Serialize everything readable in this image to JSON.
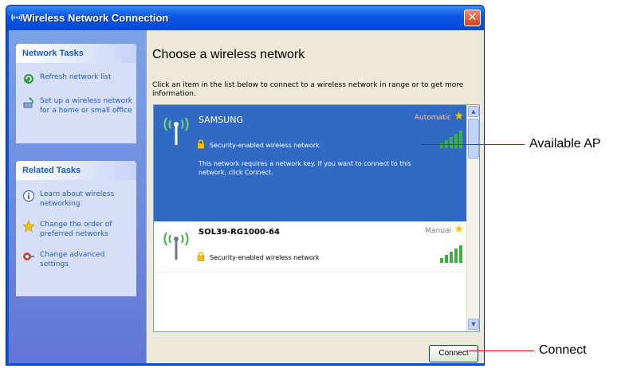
{
  "window": {
    "title": "Wireless Network Connection",
    "close_label": "✕"
  },
  "left_pane": {
    "network_tasks": {
      "header": "Network Tasks",
      "items": [
        {
          "label": "Refresh network list",
          "icon": "refresh-icon"
        },
        {
          "label": "Set up a wireless network for a home or small office",
          "icon": "wireless-setup-icon"
        }
      ]
    },
    "related_tasks": {
      "header": "Related Tasks",
      "items": [
        {
          "label": "Learn about wireless networking",
          "icon": "info-icon"
        },
        {
          "label": "Change the order of preferred networks",
          "icon": "star-icon"
        },
        {
          "label": "Change advanced settings",
          "icon": "settings-icon"
        }
      ]
    }
  },
  "main": {
    "heading": "Choose a wireless network",
    "instruction": "Click an item in the list below to connect to a wireless network in range or to get more information.",
    "networks": [
      {
        "name": "SAMSUNG",
        "mode": "Automatic",
        "security": "Security-enabled wireless network",
        "description": "This network requires a network key. If you want to connect to this network, click Connect.",
        "selected": true,
        "signal_bars": 5
      },
      {
        "name": "SOL39-RG1000-64",
        "mode": "Manual",
        "security": "Security-enabled wireless network",
        "selected": false,
        "signal_bars": 5
      }
    ],
    "connect_button": "Connect"
  },
  "callouts": {
    "available_ap": "Available AP",
    "connect": "Connect"
  },
  "colors": {
    "title_bar": "#0a56e6",
    "selected_row": "#316ac5",
    "callout_line": "#d80000",
    "signal_green": "#3cb043"
  }
}
